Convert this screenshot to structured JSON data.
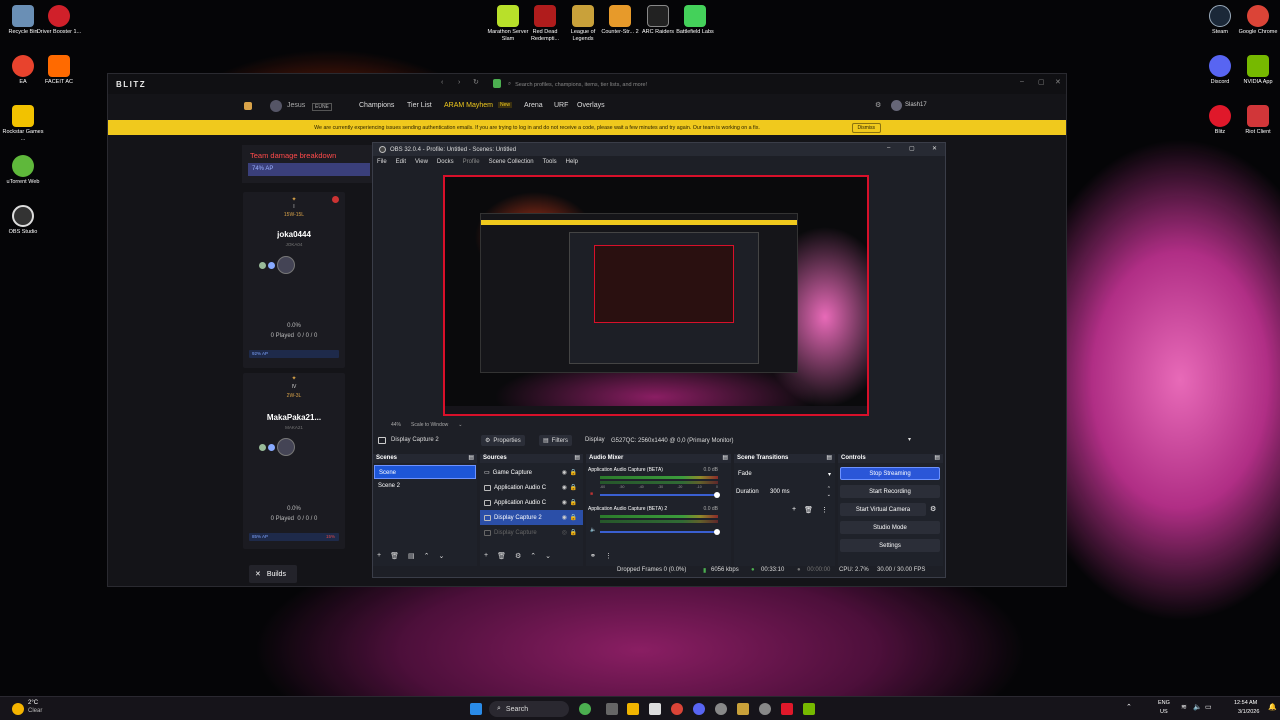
{
  "desktop": {
    "left_icons": [
      {
        "label": "Recycle Bin",
        "color": "#6a8fb5"
      },
      {
        "label": "Driver Booster 1...",
        "color": "#d0202a"
      },
      {
        "label": "EA",
        "color": "#e8432d"
      },
      {
        "label": "FACEIT AC",
        "color": "#ff6a00"
      },
      {
        "label": "Rockstar Games ...",
        "color": "#f2c200"
      },
      {
        "label": "uTorrent Web",
        "color": "#5fb83b"
      },
      {
        "label": "OBS Studio",
        "color": "#333333"
      }
    ],
    "top_icons": [
      {
        "label": "Marathon Server Slam",
        "color": "#b8e02a"
      },
      {
        "label": "Red Dead Redempti...",
        "color": "#b01c1c"
      },
      {
        "label": "League of Legends",
        "color": "#c9a13a"
      },
      {
        "label": "Counter-Str... 2",
        "color": "#e79a2a"
      },
      {
        "label": "ARC Raiders",
        "color": "#222222"
      },
      {
        "label": "Battlefield Labs",
        "color": "#44d15a"
      }
    ],
    "right_icons": [
      {
        "label": "Steam",
        "color": "#1b2838"
      },
      {
        "label": "Google Chrome",
        "color": "#db4437"
      },
      {
        "label": "Discord",
        "color": "#5865f2"
      },
      {
        "label": "NVIDIA App",
        "color": "#76b900"
      },
      {
        "label": "Blitz",
        "color": "#e0182a"
      },
      {
        "label": "Riot Client",
        "color": "#d13639"
      }
    ]
  },
  "blitz": {
    "logo": "BLITZ",
    "search_placeholder": "Search profiles, champions, items, tier lists, and more!",
    "profile": "Jesus",
    "region": "EUNE",
    "nav": [
      "Champions",
      "Tier List",
      "ARAM Mayhem",
      "Arena",
      "URF",
      "Overlays"
    ],
    "nav_badge": "New",
    "user": "Slash17",
    "banner": "We are currently experiencing issues sending authentication emails. If you are trying to log in and do not receive a code, please wait a few minutes and try again. Our team is working on a fix.",
    "dismiss": "Dismiss",
    "team_damage_title": "Team damage breakdown",
    "team_damage_value": "74% AP",
    "players": [
      {
        "rank": "I",
        "record": "15W-15L",
        "name": "joka0444",
        "tag": "JOKA04",
        "winrate": "0.0%",
        "played": "0 Played",
        "kda": "0 / 0 / 0",
        "bar": "92% AP"
      },
      {
        "rank": "IV",
        "record": "2W-3L",
        "name": "MakaPaka21...",
        "tag": "MAKA21",
        "winrate": "0.0%",
        "played": "0 Played",
        "kda": "0 / 0 / 0",
        "bar": "85% AP",
        "bar_red": "15%"
      }
    ],
    "builds": "Builds",
    "accent": "#f0c91d"
  },
  "obs": {
    "title": "OBS 32.0.4 - Profile: Untitled - Scenes: Untitled",
    "menu": [
      "File",
      "Edit",
      "View",
      "Docks",
      "Profile",
      "Scene Collection",
      "Tools",
      "Help"
    ],
    "zoom": "44%",
    "scale_mode": "Scale to Window",
    "current_source": "Display Capture 2",
    "properties": "Properties",
    "filters": "Filters",
    "display_label": "Display",
    "display_value": "G527QC: 2560x1440 @ 0,0 (Primary Monitor)",
    "scenes_title": "Scenes",
    "scenes": [
      "Scene",
      "Scene 2"
    ],
    "sources_title": "Sources",
    "sources": [
      "Game Capture",
      "Application Audio C",
      "Application Audio C",
      "Display Capture 2",
      "Display Capture"
    ],
    "mixer_title": "Audio Mixer",
    "mixer": [
      {
        "name": "Application Audio Capture (BETA)",
        "db": "0.0 dB"
      },
      {
        "name": "Application Audio Capture (BETA) 2",
        "db": "0.0 dB"
      }
    ],
    "meter_ticks": [
      "-60",
      "-55",
      "-50",
      "-45",
      "-40",
      "-35",
      "-30",
      "-25",
      "-20",
      "-15",
      "-10",
      "-5",
      "0"
    ],
    "transitions_title": "Scene Transitions",
    "transition": "Fade",
    "duration_label": "Duration",
    "duration_value": "300 ms",
    "controls_title": "Controls",
    "controls": [
      "Stop Streaming",
      "Start Recording",
      "Start Virtual Camera",
      "Studio Mode",
      "Settings"
    ],
    "status": {
      "dropped": "Dropped Frames 0 (0.0%)",
      "bitrate": "6056 kbps",
      "stream_time": "00:33:10",
      "rec_time": "00:00:00",
      "cpu": "CPU: 2.7%",
      "fps": "30.00 / 30.00 FPS"
    },
    "accent": "#2a56d8"
  },
  "taskbar": {
    "weather_temp": "2°C",
    "weather_text": "Clear",
    "search": "Search",
    "lang": "ENG",
    "region": "US",
    "time": "12:54 AM",
    "date": "3/1/2026"
  }
}
